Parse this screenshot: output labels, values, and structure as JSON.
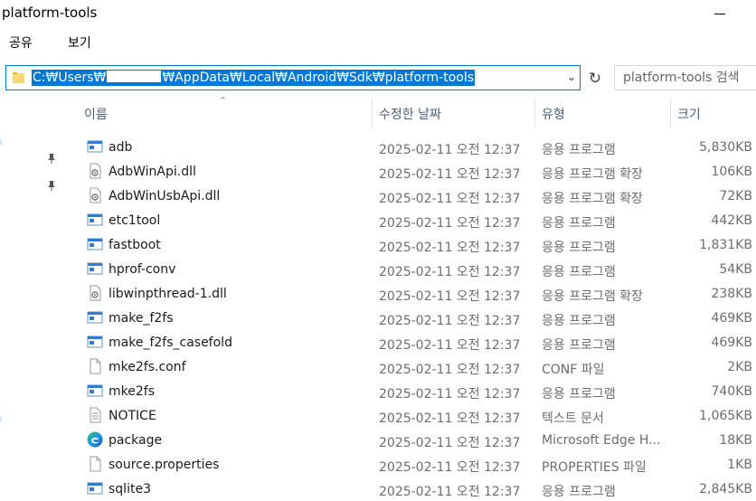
{
  "window": {
    "title": "platform-tools"
  },
  "ribbon": {
    "tabs": [
      "공유",
      "보기"
    ]
  },
  "address": {
    "path_prefix": "C:₩Users₩",
    "path_suffix": "₩AppData₩Local₩Android₩Sdk₩platform-tools"
  },
  "search": {
    "placeholder": "platform-tools 검색"
  },
  "columns": {
    "name": "이름",
    "date": "수정한 날짜",
    "type": "유형",
    "size": "크기"
  },
  "files": [
    {
      "name": "adb",
      "date": "2025-02-11 오전 12:37",
      "type": "응용 프로그램",
      "size": "5,830KB",
      "icon": "application-icon"
    },
    {
      "name": "AdbWinApi.dll",
      "date": "2025-02-11 오전 12:37",
      "type": "응용 프로그램 확장",
      "size": "106KB",
      "icon": "dll-icon"
    },
    {
      "name": "AdbWinUsbApi.dll",
      "date": "2025-02-11 오전 12:37",
      "type": "응용 프로그램 확장",
      "size": "72KB",
      "icon": "dll-icon"
    },
    {
      "name": "etc1tool",
      "date": "2025-02-11 오전 12:37",
      "type": "응용 프로그램",
      "size": "442KB",
      "icon": "application-icon"
    },
    {
      "name": "fastboot",
      "date": "2025-02-11 오전 12:37",
      "type": "응용 프로그램",
      "size": "1,831KB",
      "icon": "application-icon"
    },
    {
      "name": "hprof-conv",
      "date": "2025-02-11 오전 12:37",
      "type": "응용 프로그램",
      "size": "54KB",
      "icon": "application-icon"
    },
    {
      "name": "libwinpthread-1.dll",
      "date": "2025-02-11 오전 12:37",
      "type": "응용 프로그램 확장",
      "size": "238KB",
      "icon": "dll-icon"
    },
    {
      "name": "make_f2fs",
      "date": "2025-02-11 오전 12:37",
      "type": "응용 프로그램",
      "size": "469KB",
      "icon": "application-icon"
    },
    {
      "name": "make_f2fs_casefold",
      "date": "2025-02-11 오전 12:37",
      "type": "응용 프로그램",
      "size": "469KB",
      "icon": "application-icon"
    },
    {
      "name": "mke2fs.conf",
      "date": "2025-02-11 오전 12:37",
      "type": "CONF 파일",
      "size": "2KB",
      "icon": "file-icon"
    },
    {
      "name": "mke2fs",
      "date": "2025-02-11 오전 12:37",
      "type": "응용 프로그램",
      "size": "740KB",
      "icon": "application-icon"
    },
    {
      "name": "NOTICE",
      "date": "2025-02-11 오전 12:37",
      "type": "텍스트 문서",
      "size": "1,065KB",
      "icon": "text-file-icon"
    },
    {
      "name": "package",
      "date": "2025-02-11 오전 12:37",
      "type": "Microsoft Edge H...",
      "size": "18KB",
      "icon": "edge-icon"
    },
    {
      "name": "source.properties",
      "date": "2025-02-11 오전 12:37",
      "type": "PROPERTIES 파일",
      "size": "1KB",
      "icon": "file-icon"
    },
    {
      "name": "sqlite3",
      "date": "2025-02-11 오전 12:37",
      "type": "응용 프로그램",
      "size": "2,845KB",
      "icon": "application-icon"
    }
  ],
  "colors": {
    "accent": "#0078d7",
    "selection_text": "#ffffff",
    "header_text": "#4c607a",
    "secondary_text": "#6d6d6d"
  }
}
